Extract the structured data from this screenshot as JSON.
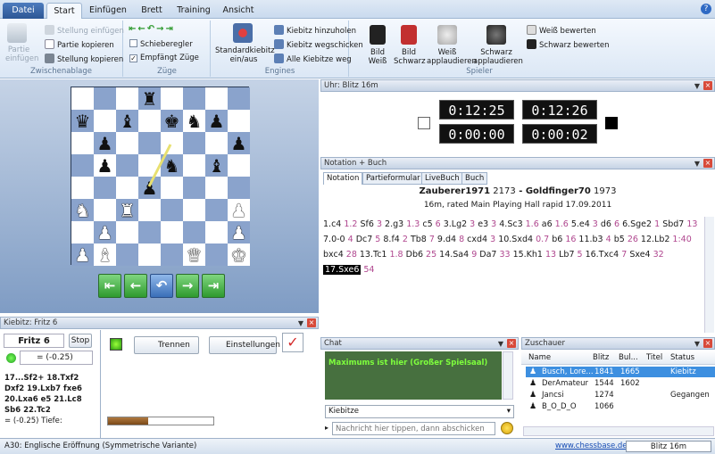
{
  "tabs": [
    "Datei",
    "Start",
    "Einfügen",
    "Brett",
    "Training",
    "Ansicht"
  ],
  "ribbon": {
    "paste_label1": "Partie",
    "paste_label2": "einfügen",
    "clipboard": [
      "Stellung einfügen",
      "Partie kopieren",
      "Stellung kopieren"
    ],
    "clipboard_group": "Zwischenablage",
    "moves_opts": [
      "Schieberegler",
      "Empfängt Züge"
    ],
    "moves_group": "Züge",
    "engine_big1": "Standardkiebitz",
    "engine_big2": "ein/aus",
    "engine_opts": [
      "Kiebitz hinzuholen",
      "Kiebitz wegschicken",
      "Alle Kiebitze weg"
    ],
    "engines_group": "Engines",
    "players": [
      {
        "l1": "Bild",
        "l2": "Weiß"
      },
      {
        "l1": "Bild",
        "l2": "Schwarz"
      },
      {
        "l1": "Weiß",
        "l2": "applaudieren"
      },
      {
        "l1": "Schwarz",
        "l2": "applaudieren"
      }
    ],
    "rate": [
      "Weiß bewerten",
      "Schwarz bewerten"
    ],
    "players_group": "Spieler"
  },
  "board": [
    [
      "",
      "",
      "",
      "r",
      "",
      "",
      "",
      ""
    ],
    [
      "bq",
      "",
      "bb",
      "",
      "bk",
      "bn",
      "bp",
      ""
    ],
    [
      "",
      "bp",
      "",
      "",
      "",
      "",
      "",
      "bp"
    ],
    [
      "",
      "bp",
      "",
      "",
      "bn",
      "",
      "bb",
      ""
    ],
    [
      "",
      "",
      "",
      "bp",
      "",
      "",
      "",
      ""
    ],
    [
      "wn",
      "",
      "wr",
      "",
      "",
      "",
      "",
      "wp"
    ],
    [
      "",
      "wp",
      "",
      "",
      "",
      "",
      "",
      "wp"
    ],
    [
      "wp",
      "wb",
      "",
      "",
      "",
      "wq",
      "",
      "wk"
    ]
  ],
  "board_overrides": {},
  "clock": {
    "title": "Uhr: Blitz 16m",
    "white": "0:12:25",
    "black": "0:12:26",
    "white_inc": "0:00:00",
    "black_inc": "0:00:02"
  },
  "notation": {
    "title": "Notation + Buch",
    "tabs": [
      "Notation",
      "Partieformular",
      "LiveBuch",
      "Buch"
    ],
    "white": "Zauberer1971",
    "white_elo": "2173",
    "sep": " - ",
    "black": "Goldfinger70",
    "black_elo": "1973",
    "event": "16m, rated Main Playing Hall rapid 17.09.2011",
    "moves": [
      [
        "m",
        "1.c4 "
      ],
      [
        "e",
        "1.2 "
      ],
      [
        "m",
        "Sf6 "
      ],
      [
        "e",
        "3 "
      ],
      [
        "m",
        "2.g3 "
      ],
      [
        "e",
        "1.3 "
      ],
      [
        "m",
        "c5 "
      ],
      [
        "e",
        "6 "
      ],
      [
        "m",
        "3.Lg2 "
      ],
      [
        "e",
        "3 "
      ],
      [
        "m",
        "e3 "
      ],
      [
        "e",
        "3 "
      ],
      [
        "m",
        "4.Sc3 "
      ],
      [
        "e",
        "1.6 "
      ],
      [
        "m",
        "a6 "
      ],
      [
        "e",
        "1.6 "
      ],
      [
        "m",
        "5.e4 "
      ],
      [
        "e",
        "3 "
      ],
      [
        "m",
        "d6 "
      ],
      [
        "e",
        "6 "
      ],
      [
        "m",
        "6.Sge2 "
      ],
      [
        "e",
        "1 "
      ],
      [
        "m",
        "Sbd7 "
      ],
      [
        "e",
        "13 "
      ],
      [
        "m",
        "7.0-0 "
      ],
      [
        "e",
        "4 "
      ],
      [
        "m",
        "Dc7 "
      ],
      [
        "e",
        "5 "
      ],
      [
        "m",
        "8.f4 "
      ],
      [
        "e",
        "2 "
      ],
      [
        "m",
        "Tb8 "
      ],
      [
        "e",
        "7 "
      ],
      [
        "m",
        "9.d4 "
      ],
      [
        "e",
        "8 "
      ],
      [
        "m",
        "cxd4 "
      ],
      [
        "e",
        "3 "
      ],
      [
        "m",
        "10.Sxd4 "
      ],
      [
        "e",
        "0.7 "
      ],
      [
        "m",
        "b6 "
      ],
      [
        "e",
        "16 "
      ],
      [
        "m",
        "11.b3 "
      ],
      [
        "e",
        "4 "
      ],
      [
        "m",
        "b5 "
      ],
      [
        "e",
        "26 "
      ],
      [
        "m",
        "12.Lb2 "
      ],
      [
        "e",
        "1:40 "
      ],
      [
        "m",
        "bxc4 "
      ],
      [
        "e",
        "28 "
      ],
      [
        "m",
        "13.Tc1 "
      ],
      [
        "e",
        "1.8 "
      ],
      [
        "m",
        "Db6 "
      ],
      [
        "e",
        "25 "
      ],
      [
        "m",
        "14.Sa4 "
      ],
      [
        "e",
        "9 "
      ],
      [
        "m",
        "Da7 "
      ],
      [
        "e",
        "33 "
      ],
      [
        "m",
        "15.Kh1 "
      ],
      [
        "e",
        "13 "
      ],
      [
        "m",
        "Lb7 "
      ],
      [
        "e",
        "5 "
      ],
      [
        "m",
        "16.Txc4 "
      ],
      [
        "e",
        "7 "
      ],
      [
        "m",
        "Sxe4 "
      ],
      [
        "e",
        "32 "
      ],
      [
        "c",
        "17.Sxe6"
      ],
      [
        "e",
        " 54"
      ]
    ]
  },
  "kibitzer": {
    "title": "Kiebitz: Fritz 6",
    "engine": "Fritz 6",
    "stop": "Stop",
    "eval": "= (-0.25)",
    "trennen": "Trennen",
    "settings": "Einstellungen",
    "lines": [
      "17...Sf2+ 18.Txf2",
      "Dxf2 19.Lxb7 fxe6",
      "20.Lxa6 e5 21.Lc8",
      "Sb6 22.Tc2"
    ],
    "depth": "= (-0.25)    Tiefe:",
    "progress": 0.38
  },
  "chat": {
    "title": "Chat",
    "message": "Maximums ist hier (Großer Spielsaal)",
    "channel": "Kiebitze",
    "placeholder": "Nachricht hier tippen, dann abschicken"
  },
  "spectators": {
    "title": "Zuschauer",
    "headers": [
      "Name",
      "Blitz",
      "Bul...",
      "Titel",
      "Status"
    ],
    "rows": [
      {
        "name": "Busch, Lore...",
        "blitz": "1841",
        "bullet": "1665",
        "title": "",
        "status": "Kiebitz"
      },
      {
        "name": "DerAmateur",
        "blitz": "1544",
        "bullet": "1602",
        "title": "",
        "status": ""
      },
      {
        "name": "Jancsi",
        "blitz": "1274",
        "bullet": "",
        "title": "",
        "status": "Gegangen"
      },
      {
        "name": "B_O_D_O",
        "blitz": "1066",
        "bullet": "",
        "title": "",
        "status": ""
      }
    ]
  },
  "status": {
    "opening": "A30: Englische Eröffnung (Symmetrische Variante)",
    "link": "www.chessbase.de",
    "mode": "Blitz 16m"
  }
}
